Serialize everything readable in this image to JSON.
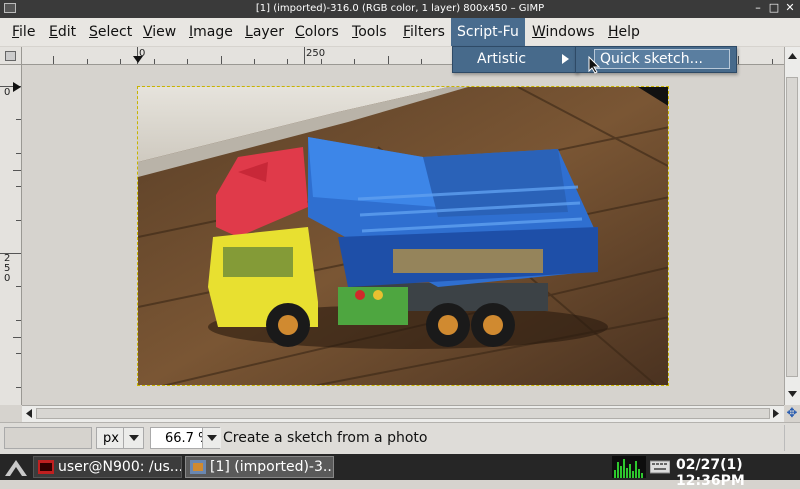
{
  "window": {
    "title": "[1] (imported)-316.0 (RGB color, 1 layer) 800x450 – GIMP",
    "minimize_symbol": "–",
    "maximize_symbol": "□",
    "close_symbol": "✕"
  },
  "menubar": {
    "items": [
      {
        "label": "File",
        "mnemonic": "F",
        "rest": "ile"
      },
      {
        "label": "Edit",
        "mnemonic": "E",
        "rest": "dit"
      },
      {
        "label": "Select",
        "mnemonic": "S",
        "rest": "elect"
      },
      {
        "label": "View",
        "mnemonic": "V",
        "rest": "iew"
      },
      {
        "label": "Image",
        "mnemonic": "I",
        "rest": "mage"
      },
      {
        "label": "Layer",
        "mnemonic": "L",
        "rest": "ayer"
      },
      {
        "label": "Colors",
        "mnemonic": "C",
        "rest": "olors"
      },
      {
        "label": "Tools",
        "mnemonic": "T",
        "rest": "ools"
      },
      {
        "label": "Filters",
        "mnemonic": "F",
        "rest": "ilters"
      },
      {
        "label": "Script-Fu",
        "mnemonic": "",
        "rest": "Script-Fu"
      },
      {
        "label": "Windows",
        "mnemonic": "W",
        "rest": "indows"
      },
      {
        "label": "Help",
        "mnemonic": "H",
        "rest": "elp"
      }
    ],
    "active": "Script-Fu"
  },
  "dropdown": {
    "submenu_label": "Artistic",
    "subitem_label": "Quick sketch..."
  },
  "rulers": {
    "top_labels": [
      "0",
      "250"
    ],
    "left_labels": [
      "0",
      "250"
    ]
  },
  "statusbar": {
    "unit": "px",
    "zoom": "66.7 %",
    "message": "Create a sketch from a photo"
  },
  "taskbar": {
    "tasks": [
      {
        "label": "user@N900: /us...",
        "active": false
      },
      {
        "label": "[1] (imported)-3...",
        "active": true
      }
    ],
    "clock": "02/27(1) 12:36PM"
  },
  "colors": {
    "menu_highlight": "#496c8e",
    "selection_marquee": "#c8b400",
    "taskbar_bg": "#262626"
  }
}
